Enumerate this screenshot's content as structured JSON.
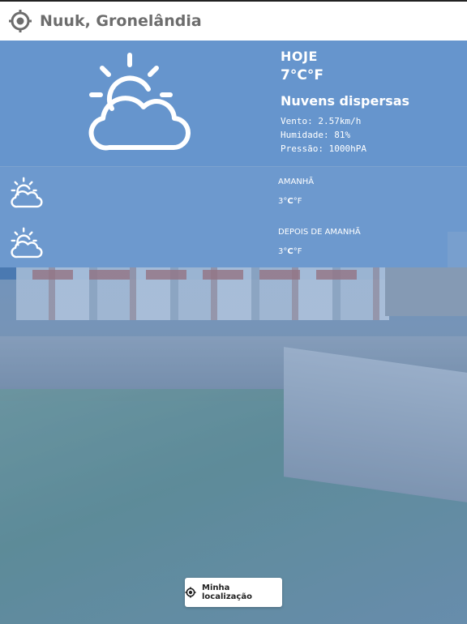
{
  "header": {
    "city": "Nuuk, Gronelândia",
    "icon": "crosshair-location-icon"
  },
  "today": {
    "day": "HOJE",
    "temp_value": "7°",
    "temp_unit_c": "C",
    "temp_unit_f": "°F",
    "description": "Nuvens dispersas",
    "wind": "Vento: 2.57km/h",
    "humidity": "Humidade: 81%",
    "pressure": "Pressão: 1000hPA",
    "icon": "partly-cloudy-icon"
  },
  "forecast": [
    {
      "day": "AMANHÃ",
      "temp_value": "3°",
      "unit_c": "C",
      "unit_f": "°F",
      "icon": "partly-cloudy-icon"
    },
    {
      "day": "DEPOIS DE AMANHÃ",
      "temp_value": "3°",
      "unit_c": "C",
      "unit_f": "°F",
      "icon": "partly-cloudy-icon"
    }
  ],
  "my_location_button": {
    "label": "Minha localização",
    "icon": "crosshair-location-icon"
  },
  "colors": {
    "panel": "#6091cd",
    "text": "#ffffff",
    "header_text": "#6d6d6d"
  }
}
